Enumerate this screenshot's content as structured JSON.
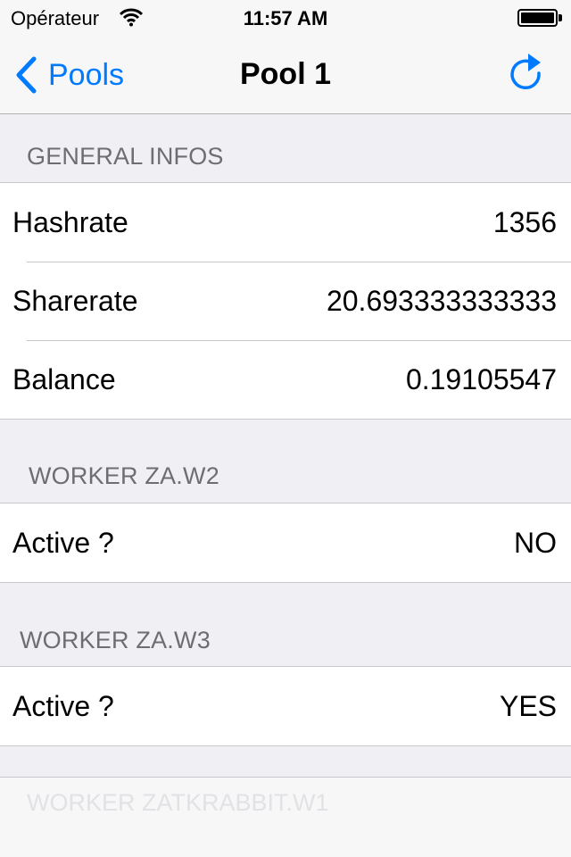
{
  "status_bar": {
    "carrier": "Opérateur",
    "time": "11:57 AM",
    "wifi_icon": "wifi-icon",
    "battery_icon": "battery-icon"
  },
  "nav_bar": {
    "back_label": "Pools",
    "title": "Pool 1",
    "refresh_icon": "refresh-icon",
    "accent_color": "#007aff"
  },
  "sections": [
    {
      "header": "GENERAL INFOS",
      "rows": [
        {
          "label": "Hashrate",
          "value": "1356"
        },
        {
          "label": "Sharerate",
          "value": "20.693333333333"
        },
        {
          "label": "Balance",
          "value": "0.19105547"
        }
      ]
    },
    {
      "header": "WORKER ZA.W2",
      "rows": [
        {
          "label": "Active ?",
          "value": "NO"
        }
      ]
    },
    {
      "header": "WORKER ZA.W3",
      "rows": [
        {
          "label": "Active ?",
          "value": "YES"
        }
      ]
    },
    {
      "header": "WORKER ZATKRABBIT.W1"
    }
  ]
}
